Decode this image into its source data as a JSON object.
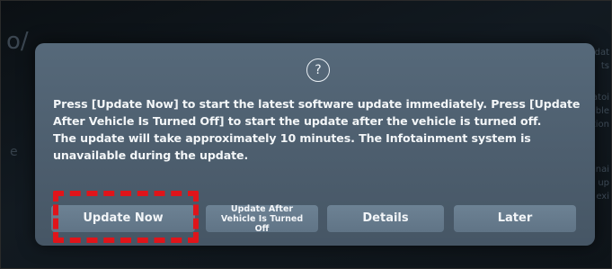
{
  "dialog": {
    "help_icon": "?",
    "message_line1": "Press [Update Now] to start the latest software update immediately. Press [Update After Vehicle Is Turned Off] to start the update after the vehicle is turned off.",
    "message_line2": "The update will take approximately 10 minutes. The Infotainment system is unavailable during the update.",
    "buttons": {
      "update_now": "Update Now",
      "update_after": "Update After Vehicle Is Turned Off",
      "details": "Details",
      "later": "Later"
    }
  },
  "highlight_color": "#e0141a"
}
